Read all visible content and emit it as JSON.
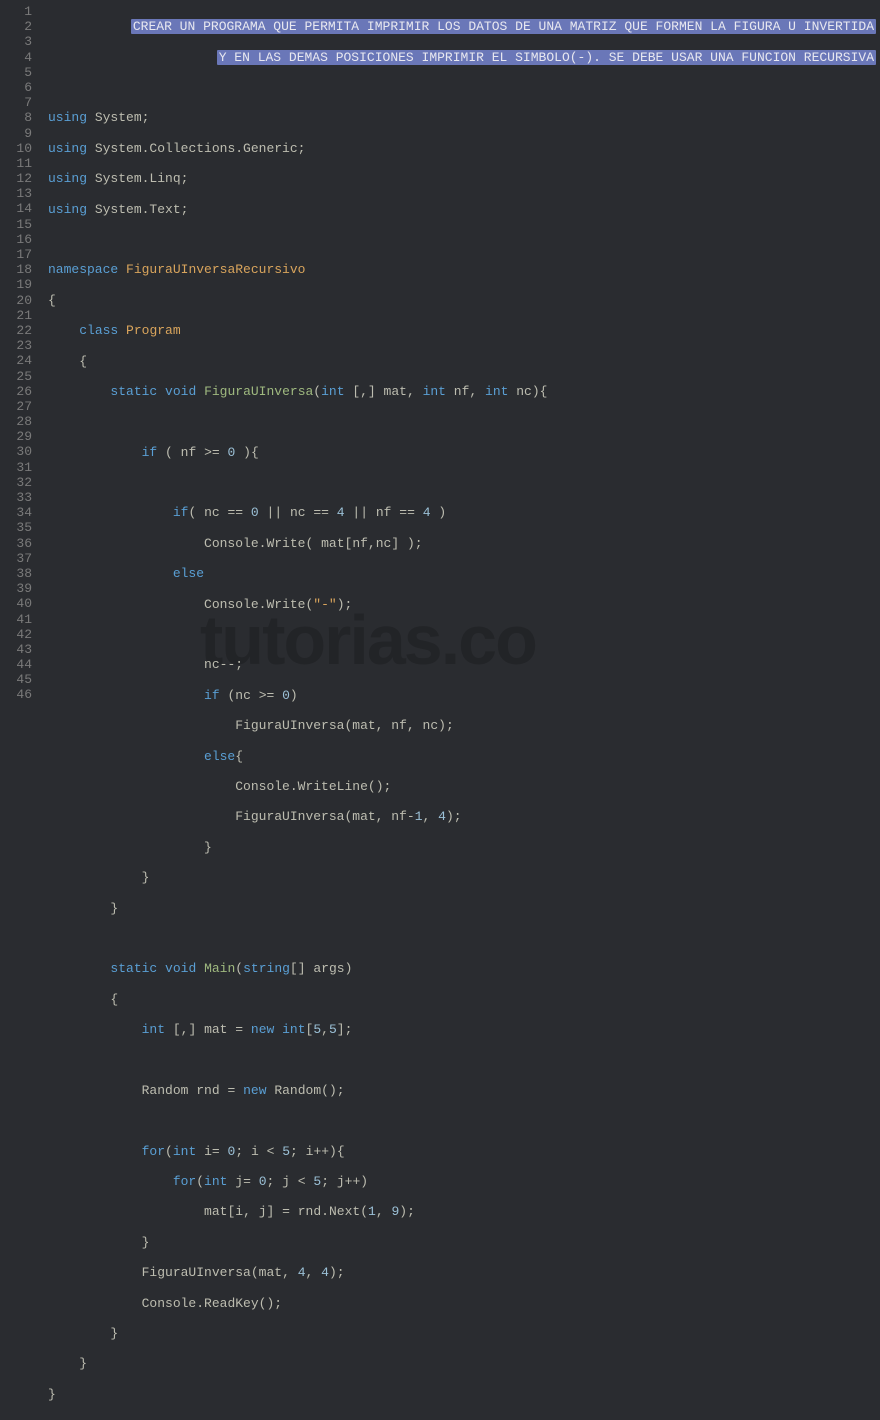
{
  "header_comment": {
    "line1": "CREAR UN PROGRAMA QUE PERMITA IMPRIMIR LOS DATOS DE UNA MATRIZ QUE FORMEN LA FIGURA U INVERTIDA",
    "line2": "Y EN LAS DEMAS POSICIONES IMPRIMIR EL SIMBOLO(-). SE DEBE USAR UNA FUNCION RECURSIVA"
  },
  "lines": {
    "ln1": "1",
    "ln2": "2",
    "ln3": "3",
    "ln4": "4",
    "ln5": "5",
    "ln6": "6",
    "ln7": "7",
    "ln8": "8",
    "ln9": "9",
    "ln10": "10",
    "ln11": "11",
    "ln12": "12",
    "ln13": "13",
    "ln14": "14",
    "ln15": "15",
    "ln16": "16",
    "ln17": "17",
    "ln18": "18",
    "ln19": "19",
    "ln20": "20",
    "ln21": "21",
    "ln22": "22",
    "ln23": "23",
    "ln24": "24",
    "ln25": "25",
    "ln26": "26",
    "ln27": "27",
    "ln28": "28",
    "ln29": "29",
    "ln30": "30",
    "ln31": "31",
    "ln32": "32",
    "ln33": "33",
    "ln34": "34",
    "ln35": "35",
    "ln36": "36",
    "ln37": "37",
    "ln38": "38",
    "ln39": "39",
    "ln40": "40",
    "ln41": "41",
    "ln42": "42",
    "ln43": "43",
    "ln44": "44",
    "ln45": "45",
    "ln46": "46"
  },
  "tokens": {
    "using": "using",
    "namespace_kw": "namespace",
    "class_kw": "class",
    "static_kw": "static",
    "void_kw": "void",
    "int_kw": "int",
    "if_kw": "if",
    "else_kw": "else",
    "new_kw": "new",
    "for_kw": "for",
    "string_kw": "string",
    "System": "System",
    "CollectionsGeneric": "System.Collections.Generic",
    "Linq": "System.Linq",
    "Text": "System.Text",
    "Namespace": "FiguraUInversaRecursivo",
    "Program": "Program",
    "FiguraUInversa": "FiguraUInversa",
    "Main": "Main",
    "Console": "Console",
    "Write": "Write",
    "WriteLine": "WriteLine",
    "ReadKey": "ReadKey",
    "Random": "Random",
    "Next": "Next",
    "mat": "mat",
    "nf": "nf",
    "nc": "nc",
    "args": "args",
    "rnd": "rnd",
    "i": "i",
    "j": "j",
    "brace_open": "{",
    "brace_close": "}",
    "paren_open": "(",
    "paren_close": ")",
    "bracket_open": "[",
    "bracket_close": "]",
    "semi": ";",
    "comma": ",",
    "dot": ".",
    "eq": "=",
    "gte": ">=",
    "eqeq": "==",
    "lt": "<",
    "minus": "-",
    "or": "||",
    "plusplus": "++",
    "minusminus": "--",
    "comma_bracket": "[,]",
    "num0": "0",
    "num1": "1",
    "num4": "4",
    "num5": "5",
    "num9": "9",
    "dashstr": "\"-\""
  },
  "watermark": "tutorias.co"
}
